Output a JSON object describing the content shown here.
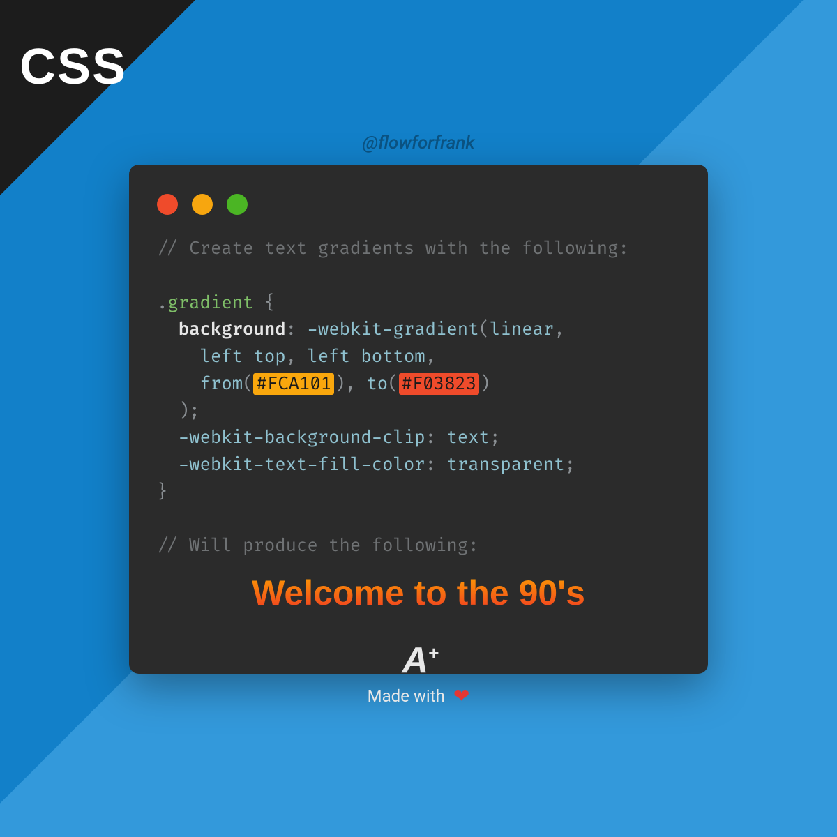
{
  "badge": {
    "label": "CSS"
  },
  "handle": "@flowforfrank",
  "code": {
    "comment1": "// Create text gradients with the following:",
    "selector": ".gradient",
    "prop_background": "background",
    "fn_webkit_gradient": "-webkit-gradient",
    "arg_linear": "linear",
    "arg_left": "left",
    "arg_top": "top",
    "arg_bottom": "bottom",
    "fn_from": "from",
    "fn_to": "to",
    "color_from": "#FCA101",
    "color_to": "#F03823",
    "prop_bg_clip": "-webkit-background-clip",
    "val_text": "text",
    "prop_fill": "-webkit-text-fill-color",
    "val_transparent": "transparent",
    "comment2": "// Will produce the following:"
  },
  "demo_text": "Welcome to the 90's",
  "footer": {
    "logo_letter": "A",
    "logo_plus": "+",
    "made_label": "Made with",
    "heart_icon": "❤"
  },
  "colors": {
    "gradient_from": "#FCA101",
    "gradient_to": "#F03823"
  }
}
